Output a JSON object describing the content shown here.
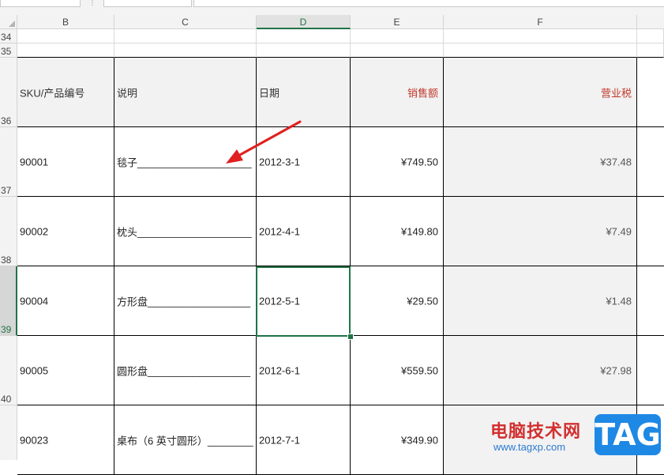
{
  "columns": [
    {
      "letter": "B",
      "key": "sku"
    },
    {
      "letter": "C",
      "key": "desc"
    },
    {
      "letter": "D",
      "key": "date"
    },
    {
      "letter": "E",
      "key": "sales"
    },
    {
      "letter": "F",
      "key": "tax"
    }
  ],
  "active_column": "D",
  "row_numbers": [
    "34",
    "35",
    "36",
    "37",
    "38",
    "39",
    "40"
  ],
  "active_row": "39",
  "header": {
    "sku": "SKU/产品编号",
    "desc": "说明",
    "date": "日期",
    "sales": "销售额",
    "tax": "营业税"
  },
  "rows": [
    {
      "sku": "90001",
      "desc": "毯子____________________",
      "date": "2012-3-1",
      "sales": "¥749.50",
      "tax": "¥37.48"
    },
    {
      "sku": "90002",
      "desc": "枕头____________________",
      "date": "2012-4-1",
      "sales": "¥149.80",
      "tax": "¥7.49"
    },
    {
      "sku": "90004",
      "desc": "方形盘__________________",
      "date": "2012-5-1",
      "sales": "¥29.50",
      "tax": "¥1.48"
    },
    {
      "sku": "90005",
      "desc": "圆形盘__________________",
      "date": "2012-6-1",
      "sales": "¥559.50",
      "tax": "¥27.98"
    },
    {
      "sku": "90023",
      "desc": "桌布（6 英寸圆形）________",
      "date": "2012-7-1",
      "sales": "¥349.90",
      "tax": ""
    }
  ],
  "watermark": {
    "site_name": "电脑技术网",
    "url": "www.tagxp.com",
    "badge": "TAG"
  },
  "colors": {
    "accent_green": "#217346",
    "header_red": "#c0392b",
    "arrow_red": "#e02020",
    "badge_blue": "#1e88e5"
  }
}
